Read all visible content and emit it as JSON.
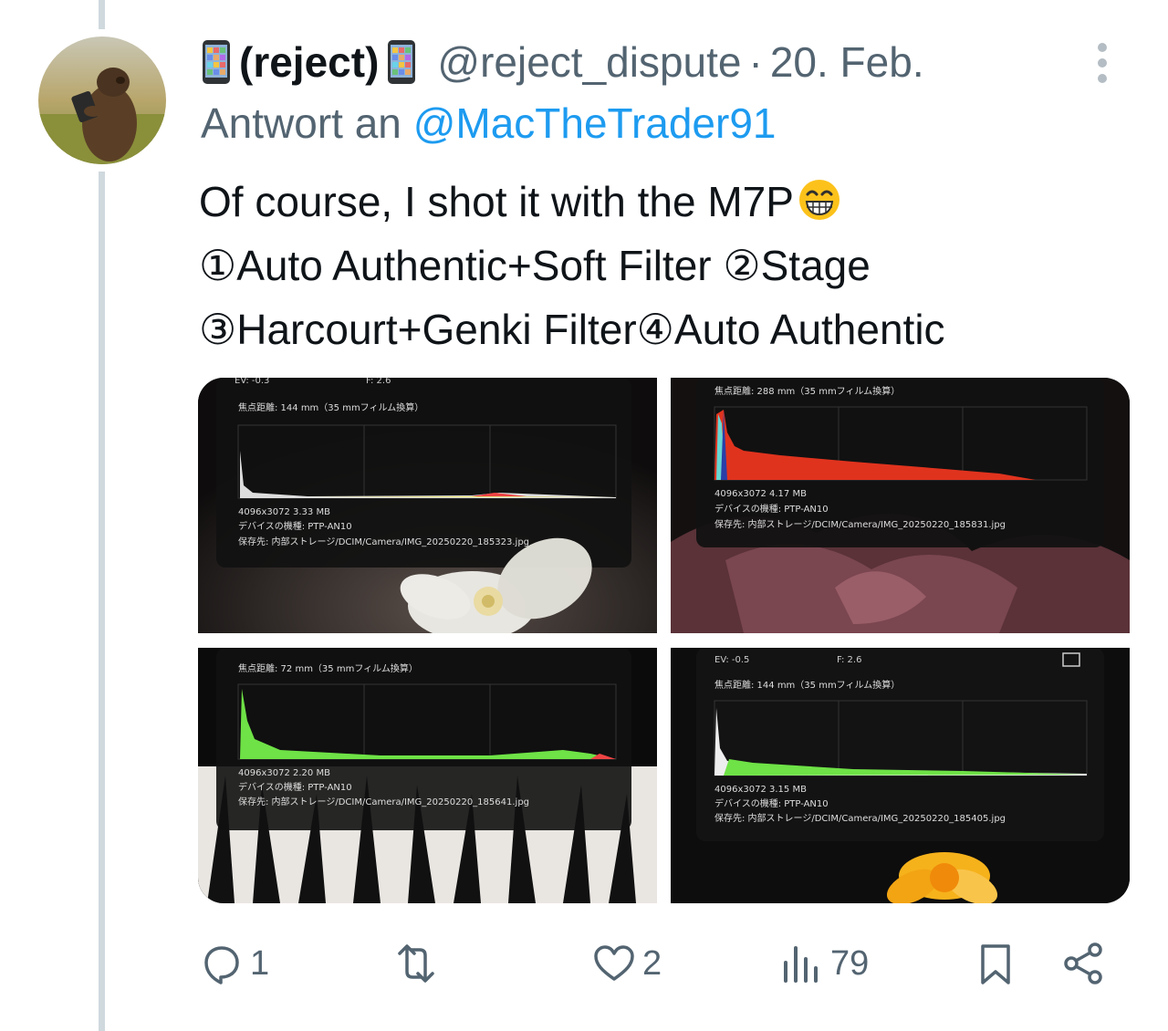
{
  "post": {
    "display_name": "(reject)",
    "handle": "@reject_dispute",
    "separator": "·",
    "date": "20. Feb.",
    "reply_prefix": "Antwort an",
    "reply_mention": "@MacTheTrader91",
    "text_lines": [
      "Of course, I shot it with the M7P",
      "①Auto Authentic+Soft Filter ②Stage",
      "③Harcourt+Genki Filter④Auto Authentic"
    ],
    "emoji": "grinning-face-with-smiling-eyes"
  },
  "media": [
    {
      "ev": "EV: -0.3",
      "f": "F: 2.6",
      "focal": "焦点距離: 144 mm（35 mmフィルム換算）",
      "resolution": "4096x3072  3.33 MB",
      "device": "デバイスの機種:  PTP-AN10",
      "path": "保存先:  内部ストレージ/DCIM/Camera/IMG_20250220_185323.jpg"
    },
    {
      "focal": "焦点距離: 288 mm（35 mmフィルム換算）",
      "resolution": "4096x3072  4.17 MB",
      "device": "デバイスの機種:  PTP-AN10",
      "path": "保存先:  内部ストレージ/DCIM/Camera/IMG_20250220_185831.jpg"
    },
    {
      "focal": "焦点距離: 72 mm（35 mmフィルム換算）",
      "resolution": "4096x3072  2.20 MB",
      "device": "デバイスの機種:  PTP-AN10",
      "path": "保存先:  内部ストレージ/DCIM/Camera/IMG_20250220_185641.jpg"
    },
    {
      "ev": "EV: -0.5",
      "f": "F: 2.6",
      "focal": "焦点距離: 144 mm（35 mmフィルム換算）",
      "resolution": "4096x3072  3.15 MB",
      "device": "デバイスの機種:  PTP-AN10",
      "path": "保存先:  内部ストレージ/DCIM/Camera/IMG_20250220_185405.jpg"
    }
  ],
  "actions": {
    "replies": "1",
    "reposts": "",
    "likes": "2",
    "views": "79"
  },
  "colors": {
    "text": "#0f1419",
    "secondary": "#536471",
    "link": "#1d9bf0",
    "thread_line": "#cfd9de"
  }
}
